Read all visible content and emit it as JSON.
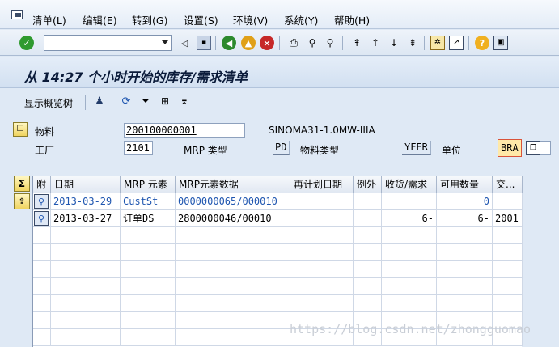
{
  "menu": [
    "清单(L)",
    "编辑(E)",
    "转到(G)",
    "设置(S)",
    "环境(V)",
    "系统(Y)",
    "帮助(H)"
  ],
  "title": "从 14:27 个小时开始的库存/需求清单",
  "app_toolbar": {
    "overview_label": "显示概览树"
  },
  "header": {
    "material_label": "物料",
    "material_value": "200100000001",
    "material_desc": "SINOMA31-1.0MW-IIIA",
    "plant_label": "工厂",
    "plant_value": "2101",
    "mrp_type_label": "MRP 类型",
    "mrp_type_value": "PD",
    "material_type_label": "物料类型",
    "material_type_value": "YFER",
    "unit_label": "单位",
    "unit_value": "BRA"
  },
  "table": {
    "columns": [
      "附",
      "日期",
      "MRP 元素",
      "MRP元素数据",
      "再计划日期",
      "例外",
      "收货/需求",
      "可用数量",
      "交..."
    ],
    "rows": [
      {
        "date": "2013-03-29",
        "element": "CustSt",
        "data": "0000000065/000010",
        "reschedule": "",
        "exception": "",
        "receipt": "",
        "available": "0",
        "plant": "",
        "highlight": true
      },
      {
        "date": "2013-03-27",
        "element": "订单DS",
        "data": "2800000046/00010",
        "reschedule": "",
        "exception": "",
        "receipt": "6-",
        "available": "6-",
        "plant": "2001",
        "highlight": false
      }
    ]
  },
  "watermark": "https://blog.csdn.net/zhongguomao",
  "colors": {
    "background": "#dfe9f5",
    "link_blue": "#1f56b0",
    "unit_highlight": "#ffe9a8"
  }
}
